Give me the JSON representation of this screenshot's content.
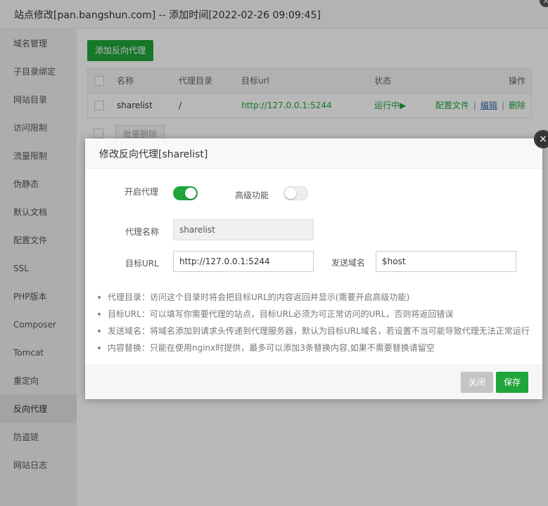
{
  "window": {
    "title": "站点修改[pan.bangshun.com] -- 添加时间[2022-02-26 09:09:45]",
    "close_glyph": "×"
  },
  "sidebar": {
    "items": [
      {
        "label": "域名管理"
      },
      {
        "label": "子目录绑定"
      },
      {
        "label": "网站目录"
      },
      {
        "label": "访问限制"
      },
      {
        "label": "流量限制"
      },
      {
        "label": "伪静态"
      },
      {
        "label": "默认文档"
      },
      {
        "label": "配置文件"
      },
      {
        "label": "SSL"
      },
      {
        "label": "PHP版本"
      },
      {
        "label": "Composer"
      },
      {
        "label": "Tomcat"
      },
      {
        "label": "重定向"
      },
      {
        "label": "反向代理",
        "active": true
      },
      {
        "label": "防盗链"
      },
      {
        "label": "网站日志"
      }
    ]
  },
  "proxy_panel": {
    "add_button": "添加反向代理",
    "table": {
      "headers": [
        "名称",
        "代理目录",
        "目标url",
        "状态",
        "操作"
      ],
      "rows": [
        {
          "name": "sharelist",
          "dir": "/",
          "target": "http://127.0.0.1:5244",
          "status": "运行中▶",
          "op_config": "配置文件",
          "op_edit": "编辑",
          "op_delete": "删除",
          "separator": "|"
        }
      ]
    },
    "batch_delete": "批量删除"
  },
  "modal": {
    "title": "修改反向代理[sharelist]",
    "close_glyph": "×",
    "enable_label": "开启代理",
    "enable_on": true,
    "advanced_label": "高级功能",
    "advanced_on": false,
    "name_label": "代理名称",
    "name_value": "sharelist",
    "url_label": "目标URL",
    "url_value": "http://127.0.0.1:5244",
    "domain_label": "发送域名",
    "domain_value": "$host",
    "tips": [
      "代理目录：访问这个目录时将会把目标URL的内容返回并显示(需要开启高级功能)",
      "目标URL：可以填写你需要代理的站点，目标URL必须为可正常访问的URL，否则将返回错误",
      "发送域名：将域名添加到请求头传递到代理服务器，默认为目标URL域名，若设置不当可能导致代理无法正常运行",
      "内容替换：只能在使用nginx时提供，最多可以添加3条替换内容,如果不需要替换请留空"
    ],
    "close_button": "关闭",
    "save_button": "保存"
  },
  "colors": {
    "accent": "#20a53a",
    "link": "#306aa6"
  }
}
